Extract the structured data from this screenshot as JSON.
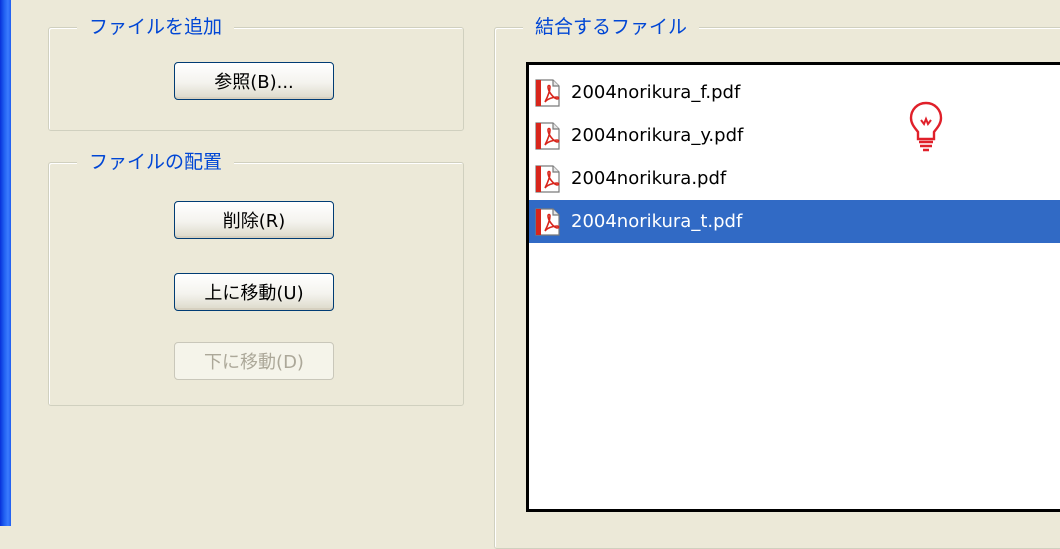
{
  "add_files_group": {
    "legend": "ファイルを追加",
    "browse_button": "参照(B)..."
  },
  "arrange_group": {
    "legend": "ファイルの配置",
    "delete_button": "削除(R)",
    "move_up_button": "上に移動(U)",
    "move_down_button": "下に移動(D)"
  },
  "combine_group": {
    "legend": "結合するファイル",
    "files": [
      {
        "name": "2004norikura_f.pdf",
        "selected": false,
        "icon": "pdf-icon"
      },
      {
        "name": "2004norikura_y.pdf",
        "selected": false,
        "icon": "pdf-icon"
      },
      {
        "name": "2004norikura.pdf",
        "selected": false,
        "icon": "pdf-icon"
      },
      {
        "name": "2004norikura_t.pdf",
        "selected": true,
        "icon": "pdf-icon"
      }
    ]
  },
  "colors": {
    "legend_text": "#0046d5",
    "selection": "#316ac5",
    "dialog_bg": "#ece9d8"
  }
}
